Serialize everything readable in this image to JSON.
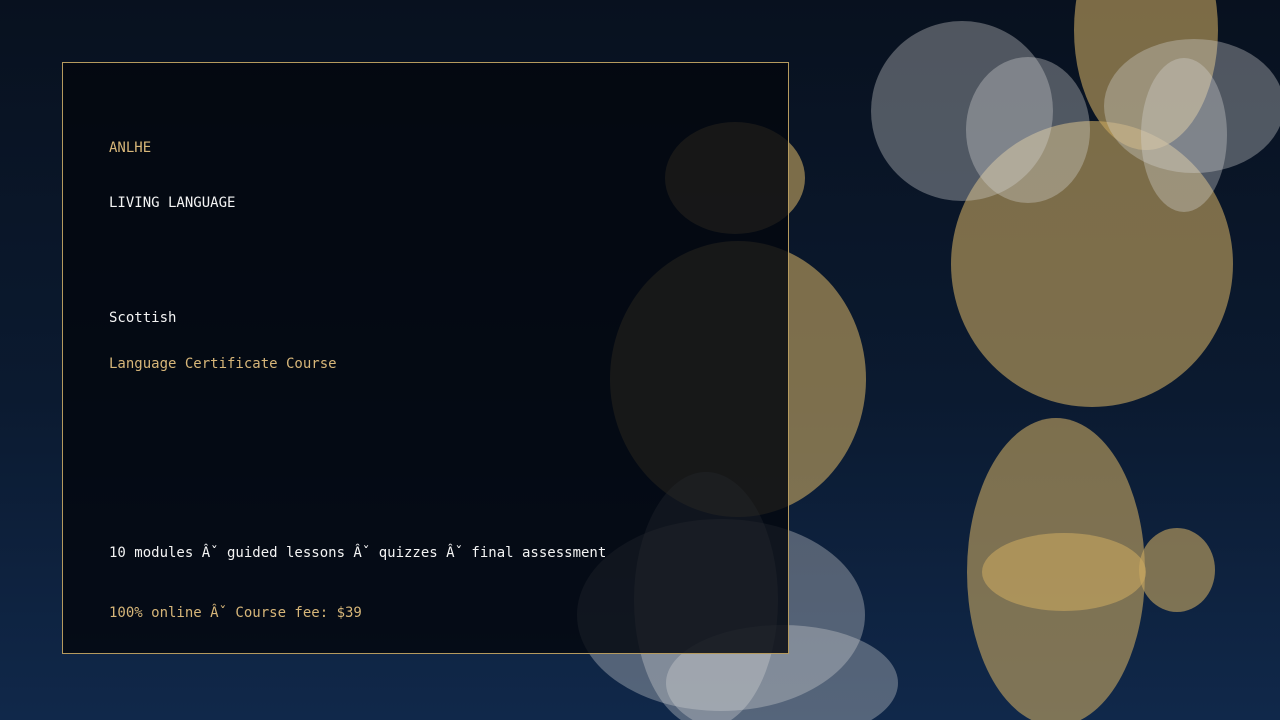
{
  "brand": "ANLHE",
  "tagline": "LIVING LANGUAGE",
  "language": "Scottish",
  "course_title": "Language Certificate Course",
  "features": "10 modules Âˇ guided lessons Âˇ quizzes Âˇ final assessment",
  "fee_line": "100% online Âˇ Course fee: $39",
  "colors": {
    "accent_gold": "#d7b679",
    "text_white": "#f4f4f4",
    "card_border": "#b59a5e",
    "background_top": "#08111f",
    "background_bottom": "#10284a",
    "bokeh_gold": "#c9a961",
    "bokeh_white": "#d8d8d8"
  }
}
